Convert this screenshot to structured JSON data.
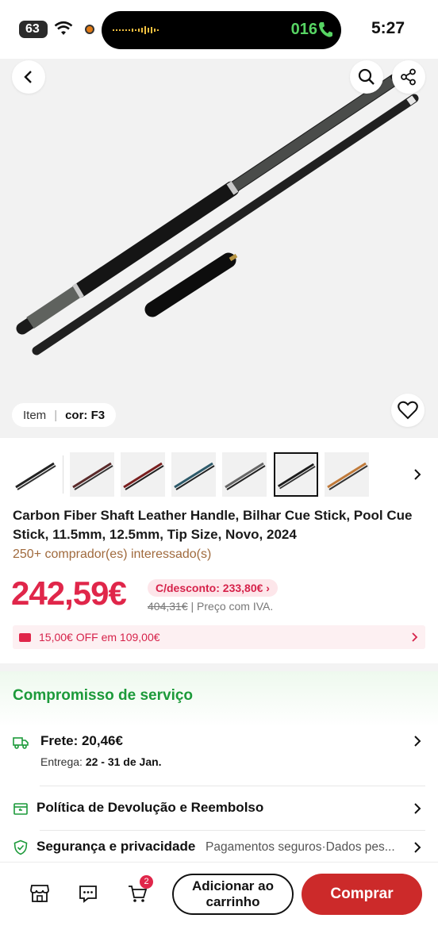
{
  "status_bar": {
    "battery": "63",
    "call_timer": "016",
    "clock": "5:27"
  },
  "gallery": {
    "variant_label": "Item",
    "variant_value": "cor: F3",
    "thumbnail_count": 8,
    "selected_thumbnail": 6
  },
  "product": {
    "title": "Carbon Fiber Shaft Leather Handle, Bilhar Cue Stick, Pool Cue Stick, 11.5mm, 12.5mm, Tip Size, Novo, 2024",
    "interest": "250+ comprador(es) interessado(s)",
    "price": "242,59€",
    "discount_badge": "C/desconto: 233,80€ ›",
    "old_price": "404,31€",
    "price_note": "| Preço com IVA.",
    "coupon": "15,00€ OFF em 109,00€"
  },
  "service": {
    "title": "Compromisso de serviço",
    "shipping_label": "Frete:  20,46€",
    "delivery_prefix": "Entrega:",
    "delivery_dates": "22 - 31 de Jan.",
    "returns_label": "Política de Devolução e Reembolso",
    "security_label": "Segurança e privacidade",
    "security_desc": "Pagamentos seguros·Dados pes..."
  },
  "bottom_bar": {
    "cart_count": "2",
    "add_to_cart": "Adicionar ao carrinho",
    "buy": "Comprar"
  },
  "colors": {
    "price_red": "#e0264a",
    "buy_button": "#cc2a2a",
    "service_green": "#1c9a3a",
    "interest_brown": "#a06a3d"
  }
}
